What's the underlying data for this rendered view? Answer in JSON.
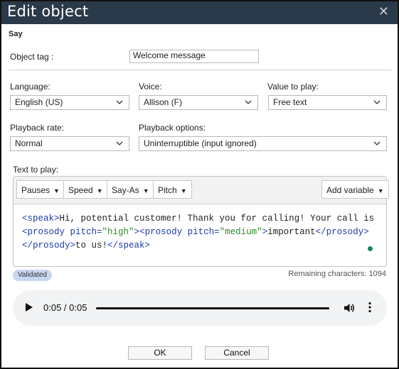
{
  "dialog": {
    "title": "Edit object",
    "close_glyph": "✕",
    "section": "Say"
  },
  "object_tag": {
    "label": "Object tag :",
    "value": "Welcome message"
  },
  "language": {
    "label": "Language:",
    "value": "English (US)"
  },
  "voice": {
    "label": "Voice:",
    "value": "Allison (F)"
  },
  "value_to_play": {
    "label": "Value to play:",
    "value": "Free text"
  },
  "playback_rate": {
    "label": "Playback rate:",
    "value": "Normal"
  },
  "playback_options": {
    "label": "Playback options:",
    "value": "Uninterruptible (input ignored)"
  },
  "text_to_play": {
    "label": "Text to play:",
    "toolbar": {
      "pauses": "Pauses",
      "speed": "Speed",
      "say_as": "Say-As",
      "pitch": "Pitch",
      "add_variable": "Add variable",
      "caret": "▼"
    },
    "code": {
      "l1_speak_open": "<speak>",
      "l1_text": "Hi, potential customer! Thank you for calling! Your call is",
      "l2_prosody1_open": "<prosody",
      "l2_attr1": " pitch=",
      "l2_val1": "\"high\"",
      "l2_close1": ">",
      "l2_prosody2_open": "<prosody",
      "l2_attr2": " pitch=",
      "l2_val2": "\"medium\"",
      "l2_close2": ">",
      "l2_text": "important",
      "l2_prosody_close": "</prosody>",
      "l3_prosody_close": "</prosody>",
      "l3_text": "to us!",
      "l3_speak_close": "</speak>"
    },
    "status_badge": "Validated",
    "remaining": "Remaining characters: 1094"
  },
  "audio": {
    "time": "0:05 / 0:05",
    "progress_fraction": 1.0
  },
  "buttons": {
    "ok": "OK",
    "cancel": "Cancel"
  },
  "colors": {
    "titlebar": "#2b3a4a",
    "xml_tag": "#1d3aa8",
    "xml_attr_value": "#2a8a2a",
    "badge_bg": "#c9d6f2",
    "status_dot": "#16806b"
  }
}
